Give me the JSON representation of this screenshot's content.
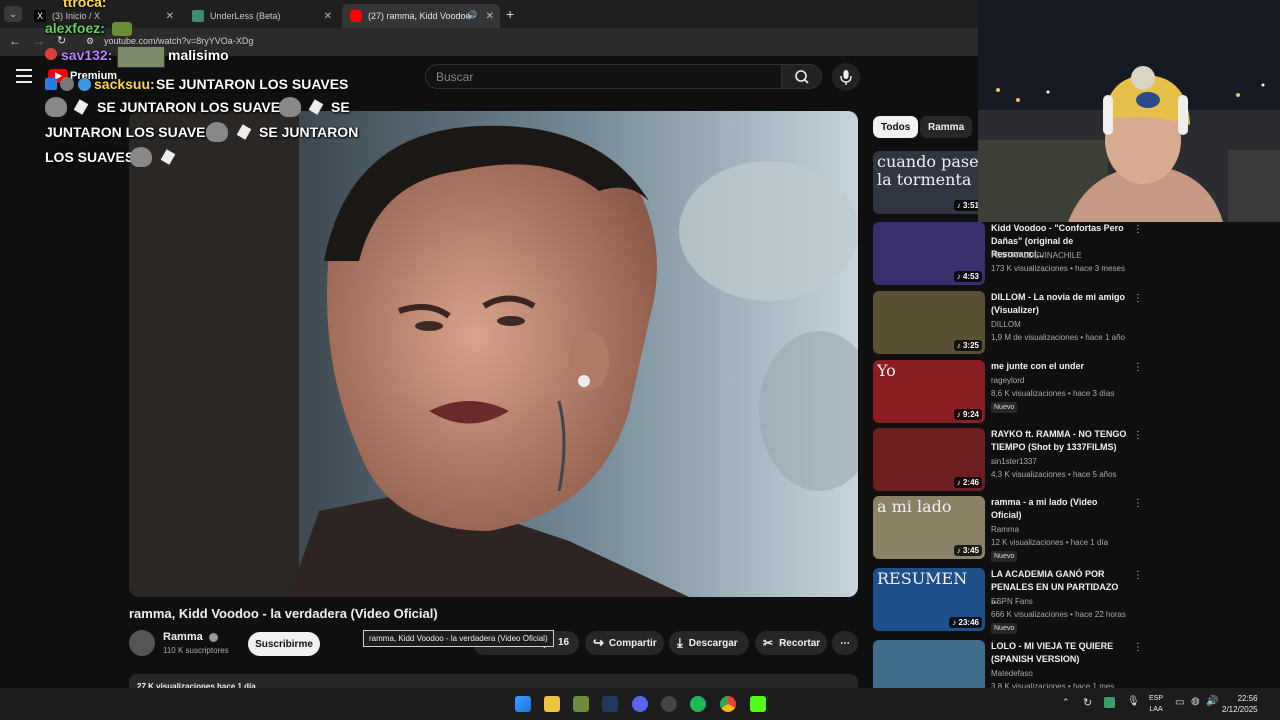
{
  "browser": {
    "tabs": [
      {
        "label": "(3) Inicio / X",
        "icon": "x-logo-icon"
      },
      {
        "label": "UnderLess (Beta)",
        "icon": "underless-icon"
      },
      {
        "label": "(27) ramma, Kidd Voodoo -",
        "icon": "youtube-icon"
      }
    ],
    "url": "youtube.com/watch?v=8ryYVOa-XDg"
  },
  "youtube": {
    "search_placeholder": "Buscar",
    "premium_label": "Premium"
  },
  "chat": {
    "lines": [
      {
        "user": "alexfoez:",
        "text": ""
      },
      {
        "user": "sav132:",
        "text": "malisimo"
      },
      {
        "user": "sacksuu:",
        "text": "SE JUNTARON LOS SUAVES"
      },
      {
        "user": "",
        "text": "SE JUNTARON LOS SUAVES"
      },
      {
        "user": "",
        "text": "SE"
      },
      {
        "user": "",
        "text": "JUNTARON LOS SUAVES"
      },
      {
        "user": "",
        "text": "SE JUNTARON"
      },
      {
        "user": "",
        "text": "LOS SUAVES"
      }
    ],
    "top_partial": "ttroca:"
  },
  "video": {
    "title": "ramma, Kidd Voodoo - la verdadera (Video Oficial)",
    "channel": "Ramma",
    "subscribers": "110 K suscriptores",
    "subscribe_label": "Suscribirme",
    "dislike_count": "16",
    "share_label": "Compartir",
    "download_label": "Descargar",
    "clip_label": "Recortar",
    "tooltip": "ramma, Kidd Voodoo - la verdadera (Video Oficial)",
    "description_stats": "27 K visualizaciones  hace 1 día"
  },
  "chips": [
    "Todos",
    "Ramma"
  ],
  "recommendations": [
    {
      "title": "",
      "channel": "",
      "meta": "",
      "duration": "3:51",
      "thumb_text": "cuando pase la tormenta",
      "thumb_color": "#2f3640",
      "badge": ""
    },
    {
      "title": "Kidd Voodoo - \"Confortas Pero Dañas\" (original de Resonanci...",
      "channel": "FESTIVALDEVINACHILE",
      "meta": "173 K visualizaciones • hace 3 meses",
      "duration": "4:53",
      "thumb_text": "",
      "thumb_color": "#3a2f6e",
      "badge": ""
    },
    {
      "title": "DILLOM - La novia de mi amigo (Visualizer)",
      "channel": "DILLOM",
      "meta": "1,9 M de visualizaciones • hace 1 año",
      "duration": "3:25",
      "thumb_text": "",
      "thumb_color": "#5a5036",
      "badge": ""
    },
    {
      "title": "me junte con el under",
      "channel": "rageylord",
      "meta": "8,6 K visualizaciones • hace 3 días",
      "duration": "9:24",
      "thumb_text": "Yo",
      "thumb_color": "#8a1d22",
      "badge": "Nuevo"
    },
    {
      "title": "RAYKO ft. RAMMA - NO TENGO TIEMPO  (Shot by 1337FILMS)",
      "channel": "sin1ster1337",
      "meta": "4,3 K visualizaciones • hace 5 años",
      "duration": "2:46",
      "thumb_text": "",
      "thumb_color": "#6e1e1e",
      "badge": ""
    },
    {
      "title": "ramma - a mi lado (Video Oficial)",
      "channel": "Ramma",
      "meta": "12 K visualizaciones • hace 1 día",
      "duration": "3:45",
      "thumb_text": "a mi lado",
      "thumb_color": "#8a8266",
      "badge": "Nuevo"
    },
    {
      "title": "LA ACADEMIA GANÓ POR PENALES EN UN PARTIDAZO ...",
      "channel": "ESPN Fans",
      "meta": "666 K visualizaciones • hace 22 horas",
      "duration": "23:46",
      "thumb_text": "RESUMEN",
      "thumb_color": "#1d4f8a",
      "badge": "Nuevo"
    },
    {
      "title": "LOLO - MI VIEJA TE QUIERE (SPANISH VERSION)",
      "channel": "Matedefaso",
      "meta": "3,8 K visualizaciones • hace 1 mes",
      "duration": "",
      "thumb_text": "",
      "thumb_color": "#3f6d8a",
      "badge": ""
    }
  ],
  "taskbar": {
    "lang_top": "ESP",
    "lang_bottom": "LAA",
    "time": "22:56",
    "date": "2/12/2025"
  },
  "colors": {
    "youtube_red": "#ff0000",
    "background": "#0f0f0f",
    "chat_green": "#5fd35f",
    "chat_yellow": "#ffd84a",
    "chat_purple": "#b980ff"
  }
}
